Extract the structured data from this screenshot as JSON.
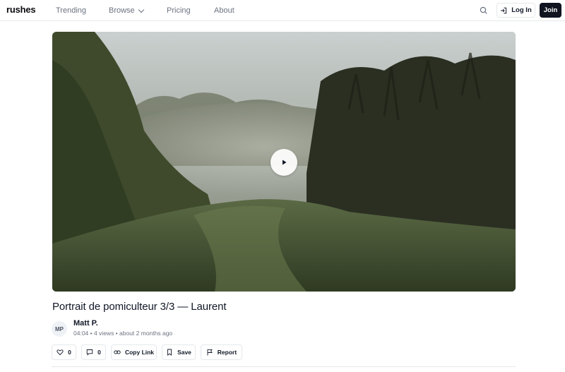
{
  "header": {
    "logo": "rushes",
    "nav": {
      "trending": "Trending",
      "browse": "Browse",
      "pricing": "Pricing",
      "about": "About"
    },
    "login_label": "Log In",
    "join_label": "Join",
    "icons": [
      "search-icon",
      "login-icon",
      "chevron-down-icon"
    ]
  },
  "video": {
    "title": "Portrait de pomiculteur 3/3 — Laurent",
    "author": {
      "initials": "MP",
      "name": "Matt P."
    },
    "meta": "04:04 • 4 views • about 2 months ago",
    "play_icon": "play-icon"
  },
  "actions": {
    "likes": "0",
    "comments": "0",
    "copy_link": "Copy Link",
    "save": "Save",
    "report": "Report",
    "icons": [
      "heart-icon",
      "comment-icon",
      "link-icon",
      "bookmark-icon",
      "flag-icon"
    ]
  },
  "colors": {
    "primary_button": "#0f1420",
    "border": "#e5e7eb",
    "muted_text": "#6b7280"
  }
}
